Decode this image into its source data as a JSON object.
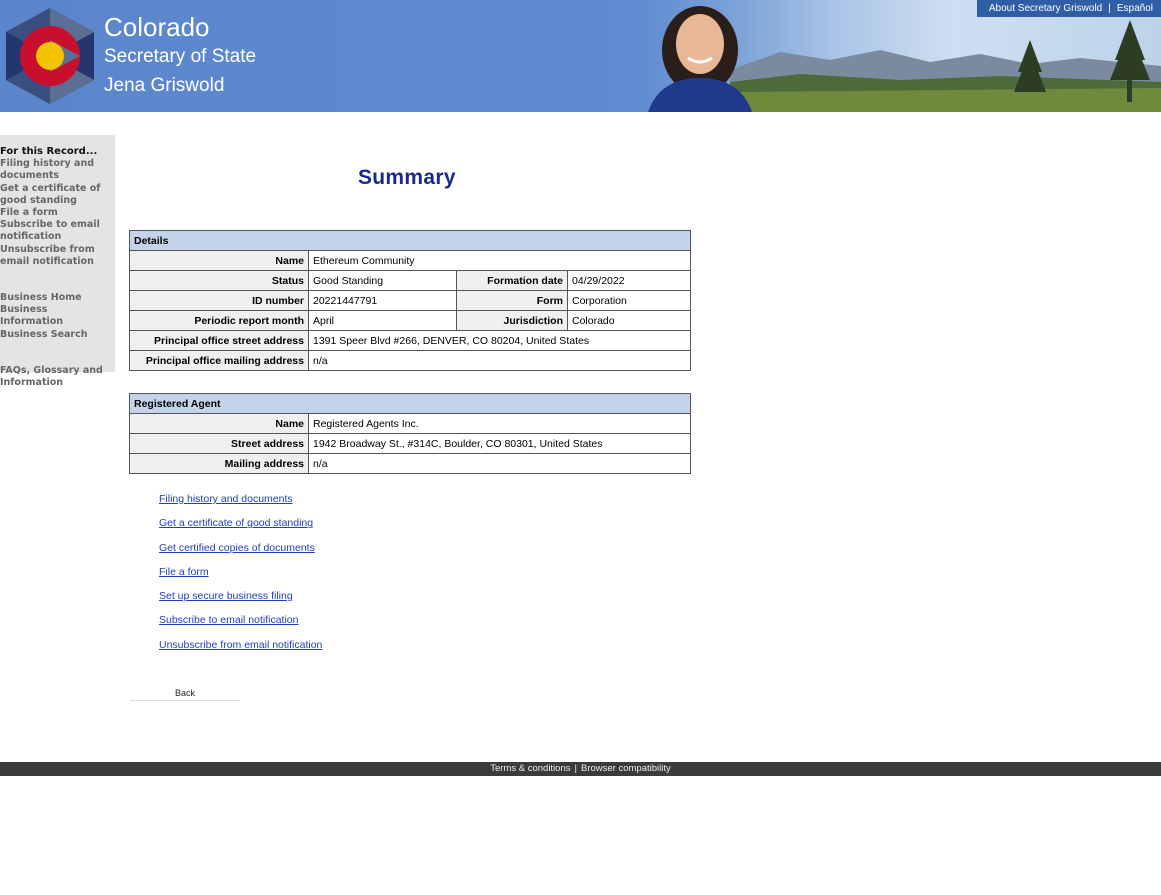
{
  "header": {
    "title": "Colorado",
    "subtitle": "Secretary of State",
    "official": "Jena Griswold",
    "top_links": [
      "About Secretary Griswold",
      "Español"
    ],
    "link_separator": "|"
  },
  "sidebar": {
    "heading": "For this Record...",
    "group1": [
      "Filing history and documents",
      "Get a certificate of good standing",
      "File a form",
      "Subscribe to email notification",
      "Unsubscribe from email notification"
    ],
    "group2": [
      "Business Home",
      "Business Information",
      "Business Search"
    ],
    "group3": [
      "FAQs, Glossary and Information"
    ]
  },
  "main": {
    "title": "Summary",
    "details": {
      "section_label": "Details",
      "name_label": "Name",
      "name": "Ethereum Community",
      "status_label": "Status",
      "status": "Good Standing",
      "formation_label": "Formation date",
      "formation": "04/29/2022",
      "id_label": "ID number",
      "id": "20221447791",
      "form_label": "Form",
      "form": "Corporation",
      "periodic_label": "Periodic report month",
      "periodic": "April",
      "jurisdiction_label": "Jurisdiction",
      "jurisdiction": "Colorado",
      "street_label": "Principal office street address",
      "street": "1391 Speer Blvd #266, DENVER, CO 80204, United States",
      "mailing_label": "Principal office mailing address",
      "mailing": "n/a"
    },
    "agent": {
      "section_label": "Registered Agent",
      "name_label": "Name",
      "name": "Registered Agents Inc.",
      "street_label": "Street address",
      "street": "1942 Broadway St., #314C, Boulder, CO 80301, United States",
      "mailing_label": "Mailing address",
      "mailing": "n/a"
    },
    "links": [
      "Filing history and documents",
      "Get a certificate of good standing",
      "Get certified copies of documents",
      "File a form",
      "Set up secure business filing",
      "Subscribe to email notification",
      "Unsubscribe from email notification"
    ],
    "back_label": "Back"
  },
  "footer": {
    "links": [
      "Terms & conditions",
      "Browser compatibility"
    ],
    "separator": "|"
  },
  "colors": {
    "header_blue": "#5b86cc",
    "title_navy": "#1a2a8a",
    "section_header": "#c3d3ea",
    "link_blue": "#1f3fbf",
    "footer_bar": "#3b3b3b"
  }
}
